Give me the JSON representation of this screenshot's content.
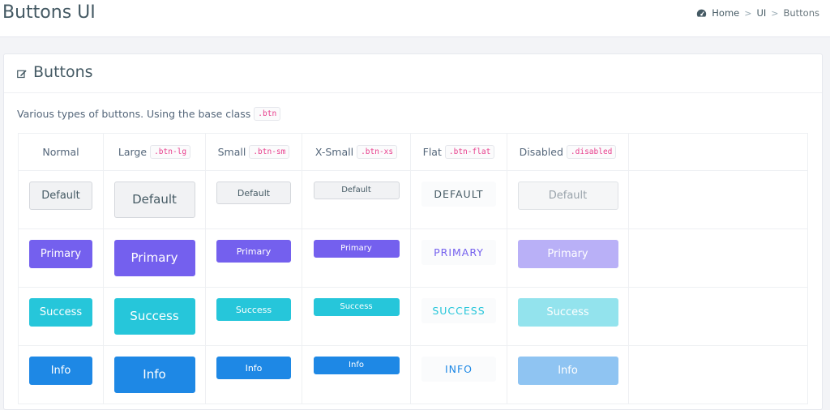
{
  "page": {
    "title": "Buttons UI"
  },
  "breadcrumb": {
    "home": "Home",
    "ui": "UI",
    "current": "Buttons",
    "separator": ">"
  },
  "card": {
    "title": "Buttons",
    "description": "Various types of buttons. Using the base class",
    "base_class": ".btn"
  },
  "columns": [
    {
      "label": "Normal",
      "code": ""
    },
    {
      "label": "Large",
      "code": ".btn-lg"
    },
    {
      "label": "Small",
      "code": ".btn-sm"
    },
    {
      "label": "X-Small",
      "code": ".btn-xs"
    },
    {
      "label": "Flat",
      "code": ".btn-flat"
    },
    {
      "label": "Disabled",
      "code": ".disabled"
    }
  ],
  "rows": [
    {
      "name": "default",
      "label": "Default",
      "flat_label": "DEFAULT"
    },
    {
      "name": "primary",
      "label": "Primary",
      "flat_label": "PRIMARY"
    },
    {
      "name": "success",
      "label": "Success",
      "flat_label": "SUCCESS"
    },
    {
      "name": "info",
      "label": "Info",
      "flat_label": "INFO"
    }
  ],
  "colors": {
    "primary": "#7460ee",
    "success": "#26c6da",
    "info": "#1e88e5",
    "default": "#f1f2f4",
    "code_text": "#e83e8c"
  },
  "icons": {
    "breadcrumb_home": "dashboard-icon",
    "card_title": "edit-icon"
  }
}
